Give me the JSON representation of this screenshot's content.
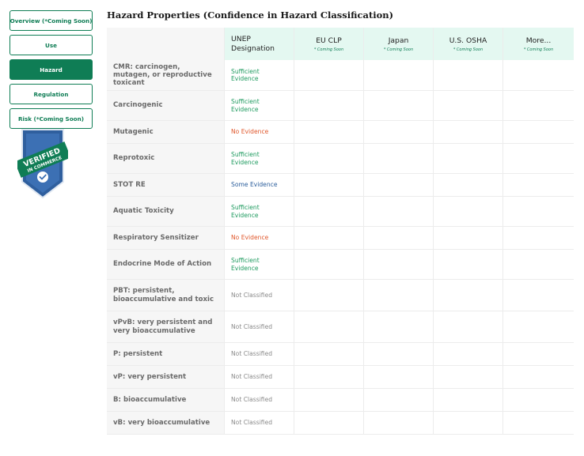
{
  "sidebar": {
    "buttons": [
      {
        "label": "Overview (*Coming Soon)",
        "active": false
      },
      {
        "label": "Use",
        "active": false
      },
      {
        "label": "Hazard",
        "active": true
      },
      {
        "label": "Regulation",
        "active": false
      },
      {
        "label": "Risk (*Coming Soon)",
        "active": false
      }
    ],
    "badge": {
      "line1": "VERIFIED",
      "line2": "IN COMMERCE",
      "icon": "check-icon"
    }
  },
  "title": "Hazard Properties (Confidence in Hazard Classification)",
  "table": {
    "headers": {
      "unep": {
        "line1": "UNEP",
        "line2": "Designation"
      },
      "regs": [
        {
          "name": "EU CLP",
          "note": "* Coming Soon"
        },
        {
          "name": "Japan",
          "note": "* Coming Soon"
        },
        {
          "name": "U.S. OSHA",
          "note": "* Coming Soon"
        },
        {
          "name": "More...",
          "note": "* Coming Soon"
        }
      ]
    },
    "rows": [
      {
        "label": "CMR: carcinogen, mutagen, or reproductive toxicant",
        "value": "Sufficient Evidence",
        "status": "suff"
      },
      {
        "label": "Carcinogenic",
        "value": "Sufficient Evidence",
        "status": "suff"
      },
      {
        "label": "Mutagenic",
        "value": "No Evidence",
        "status": "none"
      },
      {
        "label": "Reprotoxic",
        "value": "Sufficient Evidence",
        "status": "suff"
      },
      {
        "label": "STOT RE",
        "value": "Some Evidence",
        "status": "some"
      },
      {
        "label": "Aquatic Toxicity",
        "value": "Sufficient Evidence",
        "status": "suff"
      },
      {
        "label": "Respiratory Sensitizer",
        "value": "No Evidence",
        "status": "none"
      },
      {
        "label": "Endocrine Mode of Action",
        "value": "Sufficient Evidence",
        "status": "suff"
      },
      {
        "label": "PBT: persistent, bioaccumulative and toxic",
        "value": "Not Classified",
        "status": "nc"
      },
      {
        "label": "vPvB: very persistent and very bioaccumulative",
        "value": "Not Classified",
        "status": "nc"
      },
      {
        "label": "P: persistent",
        "value": "Not Classified",
        "status": "nc"
      },
      {
        "label": "vP: very persistent",
        "value": "Not Classified",
        "status": "nc"
      },
      {
        "label": "B: bioaccumulative",
        "value": "Not Classified",
        "status": "nc"
      },
      {
        "label": "vB: very bioaccumulative",
        "value": "Not Classified",
        "status": "nc"
      }
    ]
  },
  "colors": {
    "brand": "#0f7d55",
    "header_bg": "#e4f8f1",
    "sufficient": "#1d9a5e",
    "none": "#e0572b",
    "some": "#2a5d9b",
    "not_classified": "#8a8a8a"
  }
}
